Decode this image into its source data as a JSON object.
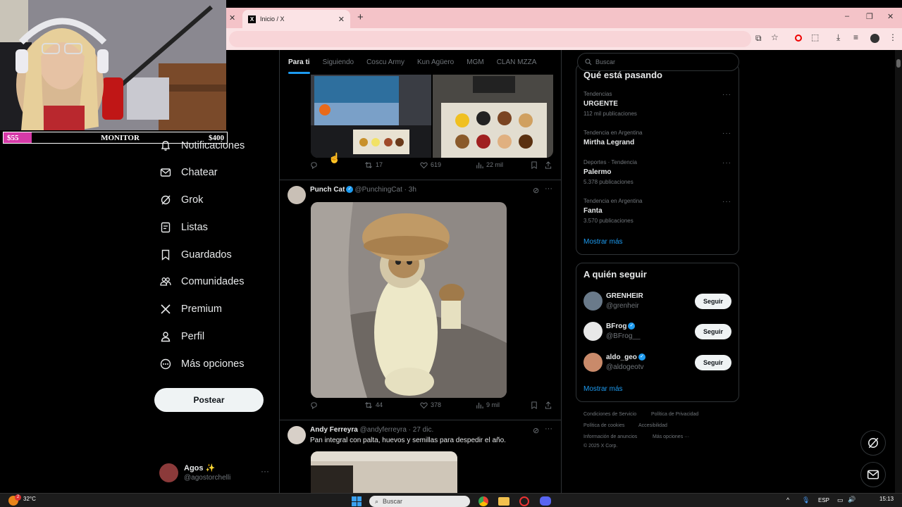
{
  "browser": {
    "tab_title": "Inicio / X",
    "new_tab": "+",
    "window_controls": [
      "–",
      "❐",
      "✕"
    ]
  },
  "overlay": {
    "bar_left": "$55",
    "bar_center": "MONITOR",
    "bar_right": "$400"
  },
  "sidebar": {
    "items": [
      {
        "label": "Notificaciones",
        "icon": "bell-icon"
      },
      {
        "label": "Chatear",
        "icon": "mail-icon"
      },
      {
        "label": "Grok",
        "icon": "grok-icon"
      },
      {
        "label": "Listas",
        "icon": "list-icon"
      },
      {
        "label": "Guardados",
        "icon": "bookmark-icon"
      },
      {
        "label": "Comunidades",
        "icon": "people-icon"
      },
      {
        "label": "Premium",
        "icon": "x-icon"
      },
      {
        "label": "Perfil",
        "icon": "person-icon"
      },
      {
        "label": "Más opciones",
        "icon": "more-circle-icon"
      }
    ],
    "post_button": "Postear",
    "account": {
      "name": "Agos ✨",
      "handle": "@agostorchelli"
    }
  },
  "feed": {
    "tabs": [
      "Para ti",
      "Siguiendo",
      "Coscu Army",
      "Kun Agüero",
      "MGM",
      "CLAN MZZA"
    ],
    "post1_actions": {
      "retweets": "17",
      "likes": "619",
      "views": "22 mil"
    },
    "post2": {
      "name": "Punch Cat",
      "handle": "@PunchingCat",
      "time": "· 3h",
      "actions": {
        "retweets": "44",
        "likes": "378",
        "views": "9 mil"
      }
    },
    "post3": {
      "name": "Andy Ferreyra",
      "handle": "@andyferreyra",
      "time": "· 27 dic.",
      "text": "Pan integral con palta, huevos y semillas para despedir el año."
    }
  },
  "right": {
    "search_placeholder": "Buscar",
    "trends_title": "Qué está pasando",
    "trends": [
      {
        "meta": "Tendencias",
        "name": "URGENTE",
        "count": "112 mil publicaciones"
      },
      {
        "meta": "Tendencia en Argentina",
        "name": "Mirtha Legrand",
        "count": ""
      },
      {
        "meta": "Deportes · Tendencia",
        "name": "Palermo",
        "count": "5.378 publicaciones"
      },
      {
        "meta": "Tendencia en Argentina",
        "name": "Fanta",
        "count": "3.570 publicaciones"
      }
    ],
    "show_more": "Mostrar más",
    "follow_title": "A quién seguir",
    "follow": [
      {
        "name": "GRENHEIR",
        "handle": "@grenheir",
        "verified": false,
        "button": "Seguir"
      },
      {
        "name": "BFrog",
        "handle": "@BFrog__",
        "verified": true,
        "button": "Seguir"
      },
      {
        "name": "aldo_geo",
        "handle": "@aldogeotv",
        "verified": true,
        "button": "Seguir"
      }
    ],
    "show_more2": "Mostrar más",
    "footer": {
      "l1a": "Condiciones de Servicio",
      "l1b": "Política de Privacidad",
      "l2a": "Política de cookies",
      "l2b": "Accesibilidad",
      "l3a": "Información de anuncios",
      "l3b": "Más opciones ···",
      "copy": "© 2025 X Corp."
    }
  },
  "taskbar": {
    "temp": "32°C",
    "search": "Buscar",
    "lang": "ESP",
    "time": "15:13",
    "notif_count": "2"
  },
  "colors": {
    "accent": "#1d9bf0",
    "tab_bg": "#f4c3c8",
    "bar_pink": "#d63aa8"
  }
}
